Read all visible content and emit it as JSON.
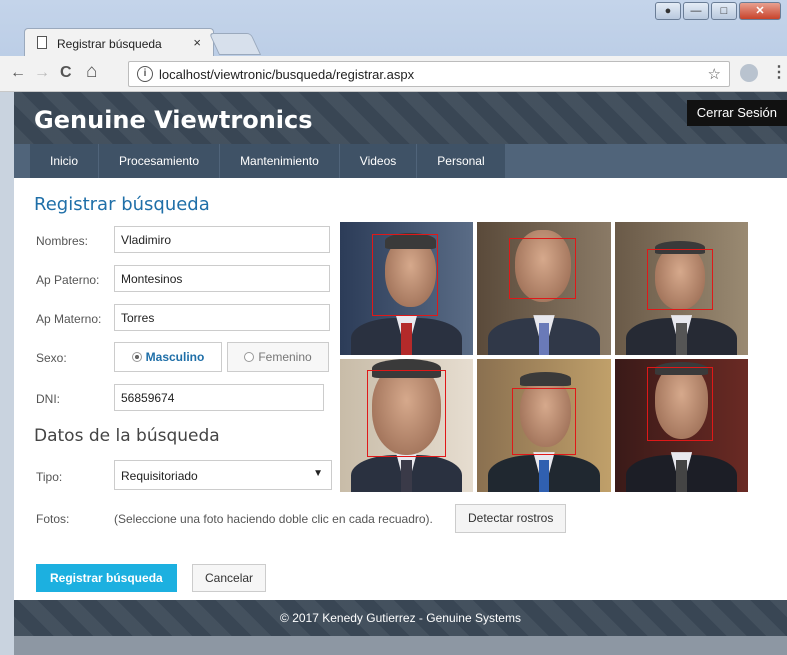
{
  "browser": {
    "tab_title": "Registrar búsqueda",
    "tab_close": "×",
    "url": "localhost/viewtronic/busqueda/registrar.aspx",
    "back": "←",
    "forward": "→",
    "reload": "C",
    "home": "⌂",
    "info": "i",
    "star": "☆",
    "menu": "⋮"
  },
  "header": {
    "brand": "Genuine Viewtronics",
    "logout": "Cerrar Sesión"
  },
  "nav": {
    "items": [
      "Inicio",
      "Procesamiento",
      "Mantenimiento",
      "Videos",
      "Personal"
    ]
  },
  "form": {
    "title": "Registrar búsqueda",
    "nombres_label": "Nombres:",
    "nombres_value": "Vladimiro",
    "paterno_label": "Ap Paterno:",
    "paterno_value": "Montesinos",
    "materno_label": "Ap Materno:",
    "materno_value": "Torres",
    "sexo_label": "Sexo:",
    "sexo_masculino": "Masculino",
    "sexo_femenino": "Femenino",
    "dni_label": "DNI:",
    "dni_value": "56859674",
    "datos_title": "Datos de la búsqueda",
    "tipo_label": "Tipo:",
    "tipo_value": "Requisitoriado",
    "fotos_label": "Fotos:",
    "fotos_hint": "(Seleccione una foto haciendo doble clic en cada recuadro).",
    "detect_button": "Detectar rostros",
    "submit_button": "Registrar búsqueda",
    "cancel_button": "Cancelar"
  },
  "footer": {
    "text": "© 2017 Kenedy Gutierrez   -   Genuine Systems"
  },
  "colors": {
    "accent": "#1cb0e0",
    "title_blue": "#1f6fa8",
    "header_bg": "#3c4a58",
    "face_box": "#e01818"
  }
}
